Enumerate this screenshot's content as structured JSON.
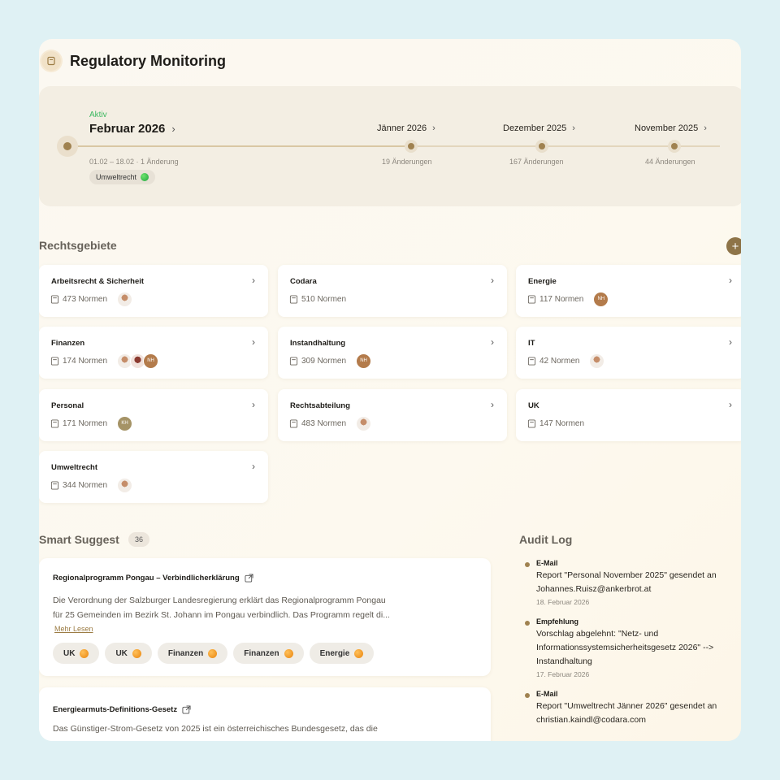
{
  "app": {
    "title": "Regulatory Monitoring"
  },
  "timeline": {
    "status": "Aktiv",
    "current": {
      "label": "Februar 2026",
      "range": "01.02 – 18.02 · 1 Änderung",
      "tag": "Umweltrecht"
    },
    "months": [
      {
        "label": "Jänner 2026",
        "count": "19 Änderungen"
      },
      {
        "label": "Dezember 2025",
        "count": "167 Änderungen"
      },
      {
        "label": "November 2025",
        "count": "44 Änderungen"
      }
    ]
  },
  "areas": {
    "title": "Rechtsgebiete",
    "add_label": "+",
    "items": [
      {
        "name": "Arbeitsrecht & Sicherheit",
        "count": "473 Normen",
        "avatars": [
          "photo"
        ]
      },
      {
        "name": "Codara",
        "count": "510 Normen",
        "avatars": []
      },
      {
        "name": "Energie",
        "count": "117 Normen",
        "avatars": [
          "NH"
        ]
      },
      {
        "name": "Finanzen",
        "count": "174 Normen",
        "avatars": [
          "photo",
          "photo2",
          "NH"
        ]
      },
      {
        "name": "Instandhaltung",
        "count": "309 Normen",
        "avatars": [
          "NH"
        ]
      },
      {
        "name": "IT",
        "count": "42 Normen",
        "avatars": [
          "photo"
        ]
      },
      {
        "name": "Personal",
        "count": "171 Normen",
        "avatars": [
          "KH"
        ]
      },
      {
        "name": "Rechtsabteilung",
        "count": "483 Normen",
        "avatars": [
          "photo"
        ]
      },
      {
        "name": "UK",
        "count": "147 Normen",
        "avatars": []
      },
      {
        "name": "Umweltrecht",
        "count": "344 Normen",
        "avatars": [
          "photo"
        ]
      }
    ]
  },
  "suggest": {
    "title": "Smart Suggest",
    "count": "36",
    "items": [
      {
        "title": "Regionalprogramm Pongau – Verbindlicherklärung",
        "desc_line1": "Die Verordnung der Salzburger Landesregierung erklärt das Regionalprogramm Pongau",
        "desc_line2": "für 25 Gemeinden im Bezirk St. Johann im Pongau verbindlich. Das Programm regelt di...",
        "read_more": "Mehr Lesen",
        "chips": [
          "UK",
          "UK",
          "Finanzen",
          "Finanzen",
          "Energie"
        ]
      },
      {
        "title": "Energiearmuts-Definitions-Gesetz",
        "desc_line1": "Das Günstiger-Strom-Gesetz von 2025 ist ein österreichisches Bundesgesetz, das die"
      }
    ]
  },
  "audit": {
    "title": "Audit Log",
    "items": [
      {
        "type": "E-Mail",
        "line1": "Report \"Personal November 2025\" gesendet an",
        "line2": "Johannes.Ruisz@ankerbrot.at",
        "date": "18. Februar 2026"
      },
      {
        "type": "Empfehlung",
        "line1": "Vorschlag abgelehnt: \"Netz- und",
        "line2": "Informationssystemsicherheitsgesetz 2026\" -->",
        "line3": "Instandhaltung",
        "date": "17. Februar 2026"
      },
      {
        "type": "E-Mail",
        "line1": "Report \"Umweltrecht Jänner 2026\" gesendet an",
        "line2": "christian.kaindl@codara.com"
      }
    ]
  }
}
